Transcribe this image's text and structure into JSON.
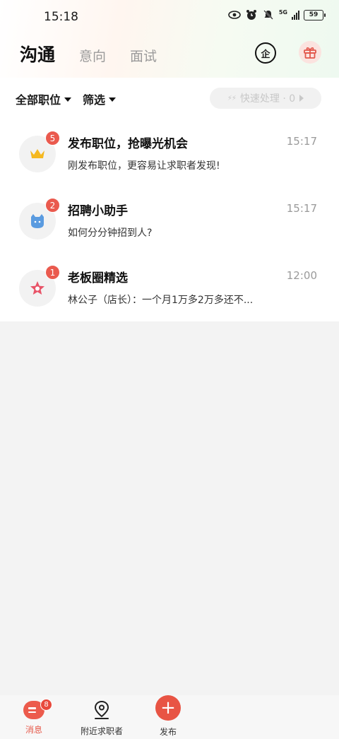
{
  "status_bar": {
    "time": "15:18",
    "network": "5G",
    "battery": "59",
    "icons": [
      "eye-icon",
      "alarm-icon",
      "mute-icon",
      "signal-icon",
      "battery-icon"
    ]
  },
  "header": {
    "tabs": [
      {
        "label": "沟通",
        "active": true
      },
      {
        "label": "意向",
        "active": false
      },
      {
        "label": "面试",
        "active": false
      }
    ],
    "company_icon_label": "企",
    "icons": [
      "company-icon",
      "gift-icon"
    ]
  },
  "filters": {
    "all_positions": "全部职位",
    "filter": "筛选",
    "quick_process": "快速处理 · 0"
  },
  "conversations": [
    {
      "title": "发布职位，抢曝光机会",
      "subtitle": "刚发布职位，更容易让求职者发现!",
      "time": "15:17",
      "badge": "5",
      "icon": "crown-icon"
    },
    {
      "title": "招聘小助手",
      "subtitle": "如何分分钟招到人?",
      "time": "15:17",
      "badge": "2",
      "icon": "assistant-cat-icon"
    },
    {
      "title": "老板圈精选",
      "subtitle": "林公子（店长）：一个月1万多2万多还不...",
      "time": "12:00",
      "badge": "1",
      "icon": "star-icon"
    }
  ],
  "bottom_nav": {
    "messages": {
      "label": "消息",
      "badge": "8",
      "active": true
    },
    "nearby": {
      "label": "附近求职者"
    },
    "publish": {
      "label": "发布",
      "icon_text": "+"
    }
  },
  "colors": {
    "accent": "#e85444",
    "badge": "#ea5a4e"
  }
}
